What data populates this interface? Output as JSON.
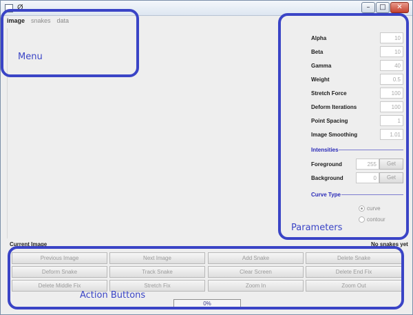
{
  "window": {
    "title": "Ø",
    "minimize_glyph": "–",
    "maximize_glyph": "□",
    "close_glyph": "✕"
  },
  "menu": {
    "items": [
      "image",
      "snakes",
      "data"
    ]
  },
  "parameters": {
    "fields": [
      {
        "label": "Alpha",
        "value": "10"
      },
      {
        "label": "Beta",
        "value": "10"
      },
      {
        "label": "Gamma",
        "value": "40"
      },
      {
        "label": "Weight",
        "value": "0.5"
      },
      {
        "label": "Stretch Force",
        "value": "100"
      },
      {
        "label": "Deform Iterations",
        "value": "100"
      },
      {
        "label": "Point Spacing",
        "value": "1"
      },
      {
        "label": "Image Smoothing",
        "value": "1.01"
      }
    ],
    "intensities_title": "Intensities",
    "intensities": [
      {
        "label": "Foreground",
        "value": "255",
        "button": "Get"
      },
      {
        "label": "Background",
        "value": "0",
        "button": "Get"
      }
    ],
    "curve_type_title": "Curve Type",
    "curve_options": [
      {
        "label": "curve",
        "selected": true
      },
      {
        "label": "contour",
        "selected": false
      }
    ]
  },
  "status": {
    "left": "Current Image",
    "right": "No snakes yet"
  },
  "actions": [
    "Previous Image",
    "Next Image",
    "Add Snake",
    "Delete Snake",
    "Deform Snake",
    "Track Snake",
    "Clear Screen",
    "Delete End Fix",
    "Delete Middle Fix",
    "Stretch Fix",
    "Zoom In",
    "Zoom Out"
  ],
  "progress": {
    "text": "0%",
    "fraction": 0
  },
  "annotations": {
    "menu": "Menu",
    "parameters": "Parameters",
    "action_buttons": "Action Buttons"
  },
  "colors": {
    "annotation": "#3a44c6",
    "section_title": "#2b2bb8"
  }
}
